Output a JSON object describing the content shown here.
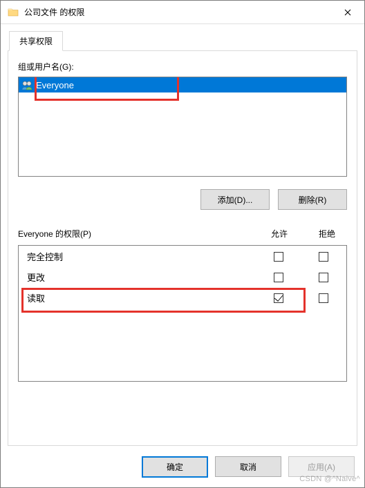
{
  "title": "公司文件 的权限",
  "tab_label": "共享权限",
  "groups_label": "组或用户名(G):",
  "groups": [
    {
      "name": "Everyone"
    }
  ],
  "buttons": {
    "add": "添加(D)...",
    "remove": "删除(R)",
    "ok": "确定",
    "cancel": "取消",
    "apply": "应用(A)"
  },
  "perm_heading": {
    "title": "Everyone 的权限(P)",
    "allow": "允许",
    "deny": "拒绝"
  },
  "permissions": [
    {
      "name": "完全控制",
      "allow": false,
      "deny": false
    },
    {
      "name": "更改",
      "allow": false,
      "deny": false
    },
    {
      "name": "读取",
      "allow": true,
      "deny": false
    }
  ],
  "watermark": "CSDN @^Naive^"
}
